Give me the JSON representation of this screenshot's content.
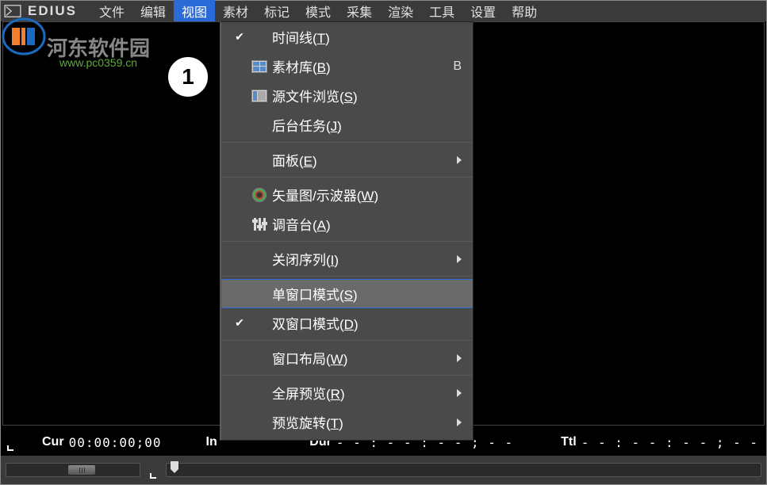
{
  "app": {
    "name": "EDIUS"
  },
  "watermark": {
    "text": "河东软件园",
    "url": "www.pc0359.cn"
  },
  "callout_number": "1",
  "menubar": [
    {
      "label": "文件"
    },
    {
      "label": "编辑"
    },
    {
      "label": "视图",
      "active": true
    },
    {
      "label": "素材"
    },
    {
      "label": "标记"
    },
    {
      "label": "模式"
    },
    {
      "label": "采集"
    },
    {
      "label": "渲染"
    },
    {
      "label": "工具"
    },
    {
      "label": "设置"
    },
    {
      "label": "帮助"
    }
  ],
  "dropdown": {
    "items": [
      {
        "type": "item",
        "checked": true,
        "label": "时间线",
        "mnemonic": "T"
      },
      {
        "type": "item",
        "icon": "thumb",
        "label": "素材库",
        "mnemonic": "B",
        "shortcut": "B"
      },
      {
        "type": "item",
        "icon": "browser",
        "label": "源文件浏览",
        "mnemonic": "S"
      },
      {
        "type": "item",
        "label": "后台任务",
        "mnemonic": "J"
      },
      {
        "type": "sep"
      },
      {
        "type": "item",
        "label": "面板",
        "mnemonic": "E",
        "submenu": true
      },
      {
        "type": "sep"
      },
      {
        "type": "item",
        "icon": "vectorscope",
        "label": "矢量图/示波器",
        "mnemonic": "W"
      },
      {
        "type": "item",
        "icon": "mixer",
        "label": "调音台",
        "mnemonic": "A"
      },
      {
        "type": "sep"
      },
      {
        "type": "item",
        "label": "关闭序列",
        "mnemonic": "I",
        "submenu": true
      },
      {
        "type": "sep"
      },
      {
        "type": "item",
        "label": "单窗口模式",
        "mnemonic": "S",
        "highlighted": true
      },
      {
        "type": "item",
        "checked": true,
        "label": "双窗口模式",
        "mnemonic": "D"
      },
      {
        "type": "sep"
      },
      {
        "type": "item",
        "label": "窗口布局",
        "mnemonic": "W",
        "submenu": true
      },
      {
        "type": "sep"
      },
      {
        "type": "item",
        "label": "全屏预览",
        "mnemonic": "R",
        "submenu": true
      },
      {
        "type": "item",
        "label": "预览旋转",
        "mnemonic": "T",
        "submenu": true
      }
    ]
  },
  "status": {
    "cur_label": "Cur",
    "cur_value": "00:00:00;00",
    "in_label": "In",
    "dur_label": "Dur",
    "dur_value": "- - : - - : - - ; - -",
    "ttl_label": "Ttl",
    "ttl_value": "- - : - - : - - ; - -"
  }
}
